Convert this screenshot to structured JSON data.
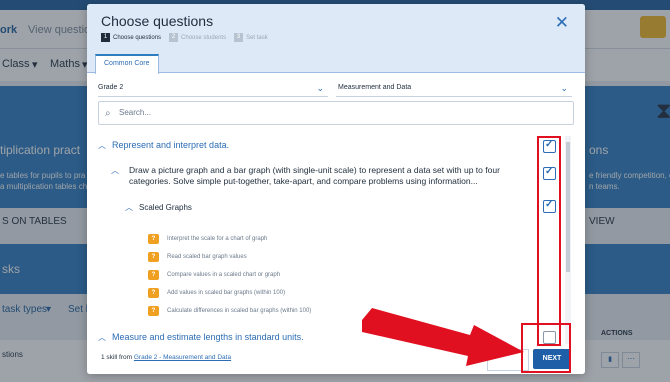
{
  "background": {
    "nav_tabs": [
      "ork",
      "View question"
    ],
    "subnav": [
      "Class",
      "Maths"
    ],
    "banner_left_title": "tiplication pract",
    "banner_left_text": "e tables for pupils to pra\na multiplication tables ch",
    "banner_left_button": "S ON TABLES",
    "banner_right_title": "ons",
    "banner_right_text": "e friendly competition, e\nn teams.",
    "banner_right_button": "VIEW",
    "tasks_label": "sks",
    "filter_task_types": "task types",
    "filter_set_by": "Set b",
    "row_label": "stions",
    "actions_header": "ACTIONS"
  },
  "modal": {
    "title": "Choose questions",
    "steps": [
      {
        "num": "1",
        "label": "Choose questions"
      },
      {
        "num": "2",
        "label": "Choose students"
      },
      {
        "num": "3",
        "label": "Set task"
      }
    ],
    "tab": "Common Core",
    "grade_select": "Grade 2",
    "domain_select": "Measurement and Data",
    "search_placeholder": "Search...",
    "section1": "Represent and interpret data.",
    "topic1": "Draw a picture graph and a bar graph (with single-unit scale) to represent a data set with up to four categories. Solve simple put-together, take-apart, and compare problems using information...",
    "subtopic1": "Scaled Graphs",
    "skills": [
      "Interpret the scale for a chart of graph",
      "Read scaled bar graph values",
      "Compare values in a scaled chart or graph",
      "Add values in scaled bar graphs (within 100)",
      "Calculate differences in scaled bar graphs (within 100)"
    ],
    "section2": "Measure and estimate lengths in standard units.",
    "footer_prefix": "1 skill from",
    "footer_link": "Grade 2 - Measurement and Data",
    "next_label": "NEXT"
  },
  "colors": {
    "accent": "#2c6db5",
    "highlight": "#e01020",
    "skill_icon": "#f0a020"
  }
}
